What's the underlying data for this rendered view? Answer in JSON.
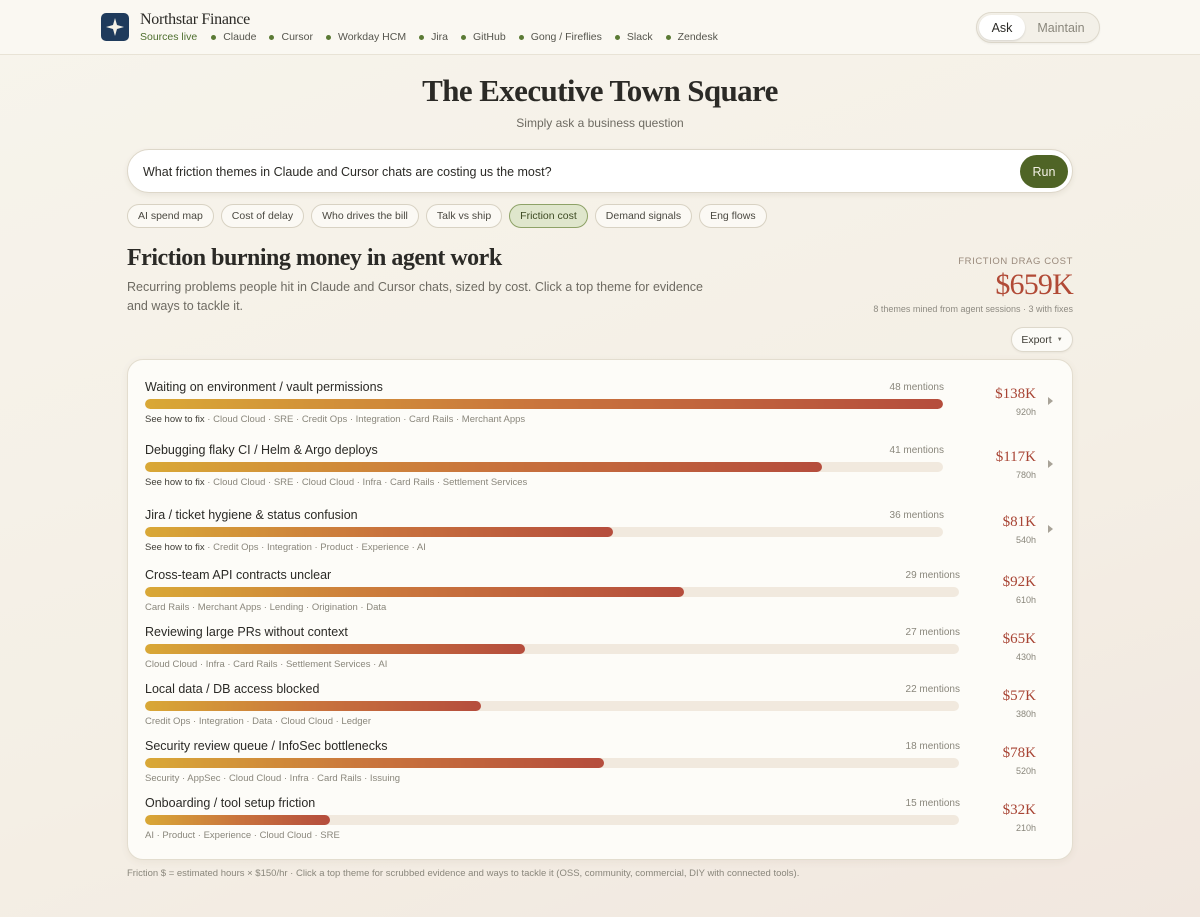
{
  "brand": {
    "name": "Northstar Finance",
    "logo_icon": "star-icon",
    "logo_color": "#1f3b5c"
  },
  "sources": {
    "status": "Sources live",
    "items": [
      "Claude",
      "Cursor",
      "Workday HCM",
      "Jira",
      "GitHub",
      "Gong / Fireflies",
      "Slack",
      "Zendesk"
    ]
  },
  "mode": {
    "active": "Ask",
    "inactive": "Maintain"
  },
  "hero": {
    "title": "The Executive Town Square",
    "subtitle": "Simply ask a business question"
  },
  "search": {
    "value": "What friction themes in Claude and Cursor chats are costing us the most?",
    "run_label": "Run"
  },
  "chips": [
    {
      "label": "AI spend map",
      "active": false
    },
    {
      "label": "Cost of delay",
      "active": false
    },
    {
      "label": "Who drives the bill",
      "active": false
    },
    {
      "label": "Talk vs ship",
      "active": false
    },
    {
      "label": "Friction cost",
      "active": true
    },
    {
      "label": "Demand signals",
      "active": false
    },
    {
      "label": "Eng flows",
      "active": false
    }
  ],
  "section": {
    "title": "Friction burning money in agent work",
    "description": "Recurring problems people hit in Claude and Cursor chats, sized by cost. Click a top theme for evidence and ways to tackle it.",
    "metric_label": "Friction drag cost",
    "metric_value": "$659K",
    "metric_note": "8 themes mined from agent sessions · 3 with fixes",
    "export_label": "Export"
  },
  "themes": [
    {
      "title": "Waiting on environment / vault permissions",
      "mentions": "48 mentions",
      "fill": 1.0,
      "fix": "See how to fix",
      "tags": "Cloud Cloud · SRE · Credit Ops · Integration · Card Rails · Merchant Apps",
      "cost": "$138K",
      "hours": "920h",
      "expandable": true
    },
    {
      "title": "Debugging flaky CI / Helm & Argo deploys",
      "mentions": "41 mentions",
      "fill": 0.848,
      "fix": "See how to fix",
      "tags": "Cloud Cloud · SRE · Cloud Cloud · Infra · Card Rails · Settlement Services",
      "cost": "$117K",
      "hours": "780h",
      "expandable": true
    },
    {
      "title": "Jira / ticket hygiene & status confusion",
      "mentions": "36 mentions",
      "fill": 0.587,
      "fix": "See how to fix",
      "tags": "Credit Ops · Integration · Product · Experience · AI",
      "cost": "$81K",
      "hours": "540h",
      "expandable": true
    },
    {
      "title": "Cross-team API contracts unclear",
      "mentions": "29 mentions",
      "fill": 0.662,
      "fix": "",
      "tags": "Card Rails · Merchant Apps · Lending · Origination · Data",
      "cost": "$92K",
      "hours": "610h",
      "expandable": false
    },
    {
      "title": "Reviewing large PRs without context",
      "mentions": "27 mentions",
      "fill": 0.467,
      "fix": "",
      "tags": "Cloud Cloud · Infra · Card Rails · Settlement Services · AI",
      "cost": "$65K",
      "hours": "430h",
      "expandable": false
    },
    {
      "title": "Local data / DB access blocked",
      "mentions": "22 mentions",
      "fill": 0.413,
      "fix": "",
      "tags": "Credit Ops · Integration · Data · Cloud Cloud · Ledger",
      "cost": "$57K",
      "hours": "380h",
      "expandable": false
    },
    {
      "title": "Security review queue / InfoSec bottlenecks",
      "mentions": "18 mentions",
      "fill": 0.564,
      "fix": "",
      "tags": "Security · AppSec · Cloud Cloud · Infra · Card Rails · Issuing",
      "cost": "$78K",
      "hours": "520h",
      "expandable": false
    },
    {
      "title": "Onboarding / tool setup friction",
      "mentions": "15 mentions",
      "fill": 0.227,
      "fix": "",
      "tags": "AI · Product · Experience · Cloud Cloud · SRE",
      "cost": "$32K",
      "hours": "210h",
      "expandable": false
    }
  ],
  "footnote": "Friction $ = estimated hours × $150/hr · Click a top theme for scrubbed evidence and ways to tackle it (OSS, community, commercial, DIY with connected tools)."
}
